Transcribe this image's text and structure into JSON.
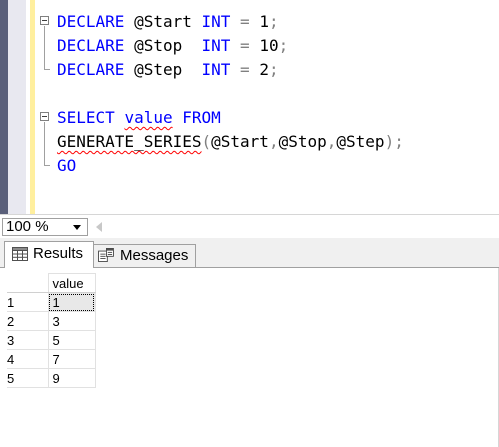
{
  "editor": {
    "lines": [
      [
        {
          "t": "DECLARE",
          "c": "kw"
        },
        {
          "t": " @Start ",
          "c": "plain"
        },
        {
          "t": "INT",
          "c": "kw"
        },
        {
          "t": " ",
          "c": "plain"
        },
        {
          "t": "=",
          "c": "gray"
        },
        {
          "t": " 1",
          "c": "plain"
        },
        {
          "t": ";",
          "c": "gray"
        }
      ],
      [
        {
          "t": "DECLARE",
          "c": "kw"
        },
        {
          "t": " @Stop  ",
          "c": "plain"
        },
        {
          "t": "INT",
          "c": "kw"
        },
        {
          "t": " ",
          "c": "plain"
        },
        {
          "t": "=",
          "c": "gray"
        },
        {
          "t": " 10",
          "c": "plain"
        },
        {
          "t": ";",
          "c": "gray"
        }
      ],
      [
        {
          "t": "DECLARE",
          "c": "kw"
        },
        {
          "t": " @Step  ",
          "c": "plain"
        },
        {
          "t": "INT",
          "c": "kw"
        },
        {
          "t": " ",
          "c": "plain"
        },
        {
          "t": "=",
          "c": "gray"
        },
        {
          "t": " 2",
          "c": "plain"
        },
        {
          "t": ";",
          "c": "gray"
        }
      ],
      [],
      [
        {
          "t": "SELECT",
          "c": "kw"
        },
        {
          "t": " ",
          "c": "plain"
        },
        {
          "t": "value",
          "c": "kw squig"
        },
        {
          "t": " ",
          "c": "plain"
        },
        {
          "t": "FROM",
          "c": "kw"
        }
      ],
      [
        {
          "t": "GENERATE_SERIES",
          "c": "plain squig"
        },
        {
          "t": "(",
          "c": "gray"
        },
        {
          "t": "@Start",
          "c": "plain"
        },
        {
          "t": ",",
          "c": "gray"
        },
        {
          "t": "@Stop",
          "c": "plain"
        },
        {
          "t": ",",
          "c": "gray"
        },
        {
          "t": "@Step",
          "c": "plain"
        },
        {
          "t": ");",
          "c": "gray"
        }
      ],
      [
        {
          "t": "GO",
          "c": "kw"
        }
      ]
    ]
  },
  "zoom": {
    "value": "100 %"
  },
  "tabs": {
    "results_label": "Results",
    "messages_label": "Messages"
  },
  "grid": {
    "header": "value",
    "rows": [
      {
        "num": "1",
        "value": "1"
      },
      {
        "num": "2",
        "value": "3"
      },
      {
        "num": "3",
        "value": "5"
      },
      {
        "num": "4",
        "value": "7"
      },
      {
        "num": "5",
        "value": "9"
      }
    ]
  },
  "icons": {
    "results": "grid-icon",
    "messages": "messages-icon",
    "zoom_dropdown": "chevron-down-icon"
  }
}
